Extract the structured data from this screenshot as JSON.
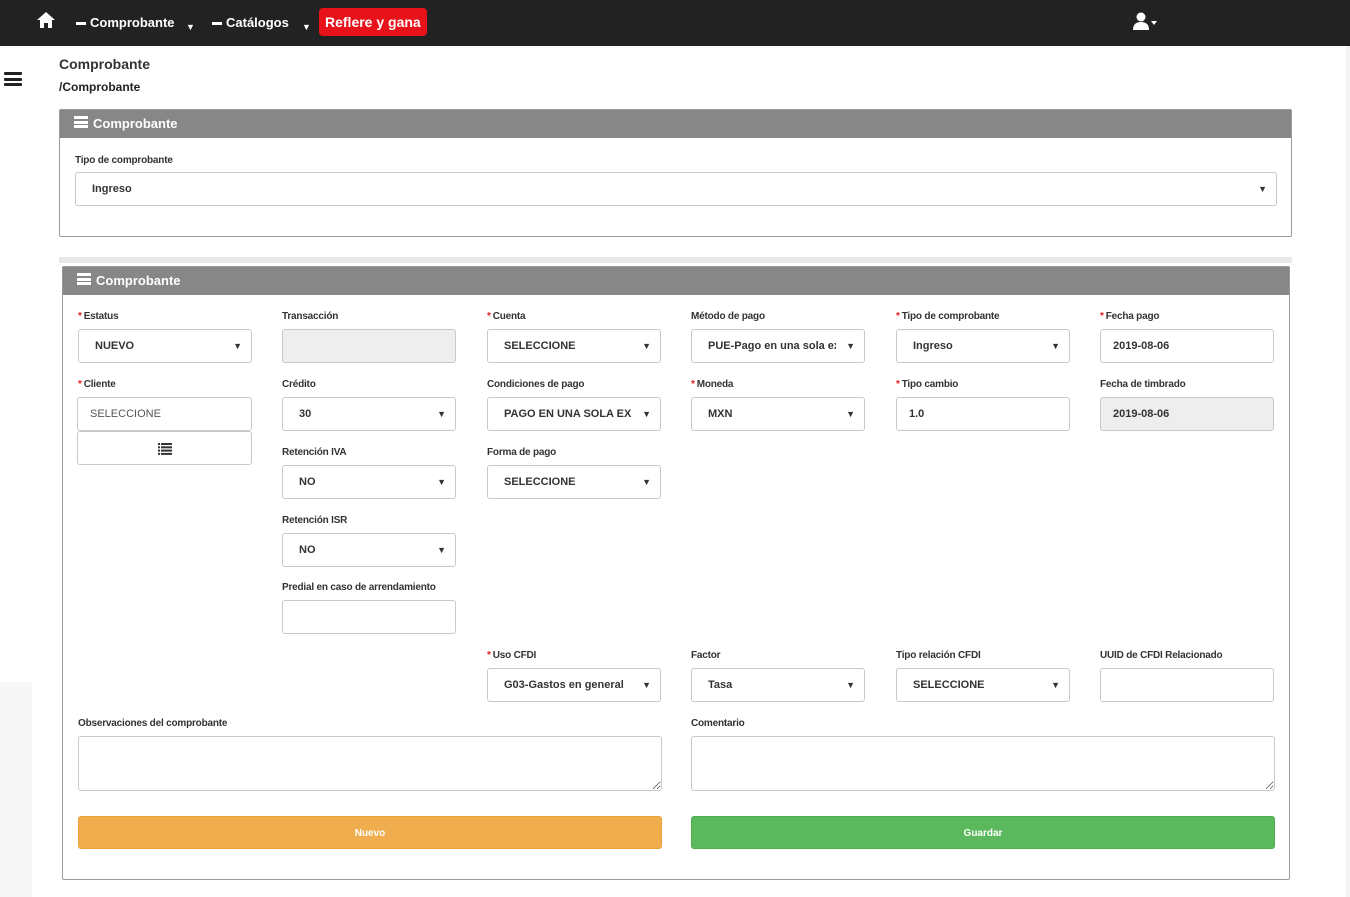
{
  "nav": {
    "home_icon": "home-icon",
    "menu1": "Comprobante",
    "menu2": "Catálogos",
    "promo": "Reflere y gana",
    "user_icon": "user-icon"
  },
  "header": {
    "title": "Comprobante",
    "breadcrumb": "/Comprobante"
  },
  "panel1": {
    "title": "Comprobante",
    "tipo_label": "Tipo de comprobante",
    "tipo_value": "Ingreso"
  },
  "panel2": {
    "title": "Comprobante",
    "fields": {
      "estatus": {
        "label": "Estatus",
        "value": "NUEVO"
      },
      "transaccion": {
        "label": "Transacción",
        "value": ""
      },
      "cuenta": {
        "label": "Cuenta",
        "value": "SELECCIONE"
      },
      "metodo_pago": {
        "label": "Método de pago",
        "value": "PUE-Pago en una sola exhibición"
      },
      "tipo_comprobante": {
        "label": "Tipo de comprobante",
        "value": "Ingreso"
      },
      "fecha_pago": {
        "label": "Fecha pago",
        "value": "2019-08-06"
      },
      "cliente": {
        "label": "Cliente",
        "placeholder": "SELECCIONE"
      },
      "credito": {
        "label": "Crédito",
        "value": "30"
      },
      "condiciones_pago": {
        "label": "Condiciones de pago",
        "value": "PAGO EN UNA SOLA EXHIBICIÓN"
      },
      "moneda": {
        "label": "Moneda",
        "value": "MXN"
      },
      "tipo_cambio": {
        "label": "Tipo cambio",
        "value": "1.0"
      },
      "fecha_timbrado": {
        "label": "Fecha de timbrado",
        "value": "2019-08-06"
      },
      "retencion_iva": {
        "label": "Retención IVA",
        "value": "NO"
      },
      "forma_pago": {
        "label": "Forma de pago",
        "value": "SELECCIONE"
      },
      "retencion_isr": {
        "label": "Retención ISR",
        "value": "NO"
      },
      "predial": {
        "label": "Predial en caso de arrendamiento",
        "value": ""
      },
      "uso_cfdi": {
        "label": "Uso CFDI",
        "value": "G03-Gastos en general"
      },
      "factor": {
        "label": "Factor",
        "value": "Tasa"
      },
      "tipo_relacion": {
        "label": "Tipo relación CFDI",
        "value": "SELECCIONE"
      },
      "uuid_relacionado": {
        "label": "UUID de CFDI Relacionado",
        "value": ""
      },
      "observaciones": {
        "label": "Observaciones del comprobante",
        "value": ""
      },
      "comentario": {
        "label": "Comentario",
        "value": ""
      }
    },
    "buttons": {
      "nuevo": "Nuevo",
      "guardar": "Guardar"
    }
  },
  "colors": {
    "topbar": "#222222",
    "promo": "#e8131a",
    "panel_header": "#878787",
    "btn_nuevo": "#f0ad4e",
    "btn_guardar": "#5cb85c",
    "required": "#e02020"
  }
}
